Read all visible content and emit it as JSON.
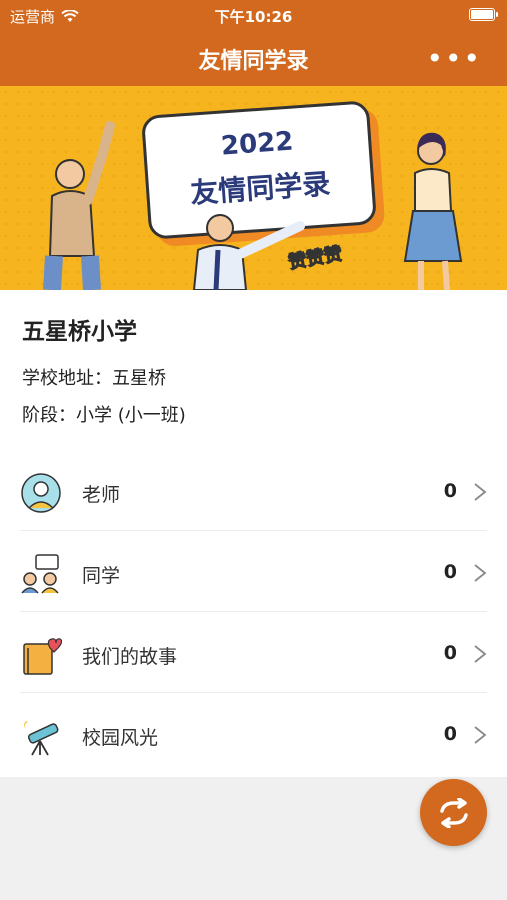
{
  "status_bar": {
    "carrier": "运营商",
    "time": "下午10:26"
  },
  "nav": {
    "title": "友情同学录",
    "more_icon": "more-dots-icon"
  },
  "banner": {
    "year": "2022",
    "title": "友情同学录",
    "zan_text": "赞赞赞"
  },
  "school": {
    "name": "五星桥小学",
    "address": "学校地址：五星桥",
    "stage": "阶段：小学 (小一班)"
  },
  "menu": [
    {
      "label": "老师",
      "count": "0",
      "icon": "teacher-icon"
    },
    {
      "label": "同学",
      "count": "0",
      "icon": "classmates-icon"
    },
    {
      "label": "我们的故事",
      "count": "0",
      "icon": "story-book-icon"
    },
    {
      "label": "校园风光",
      "count": "0",
      "icon": "telescope-icon"
    }
  ],
  "colors": {
    "brand": "#d2691e",
    "banner_bg": "#f6b51f"
  },
  "fab_icon": "refresh-icon"
}
